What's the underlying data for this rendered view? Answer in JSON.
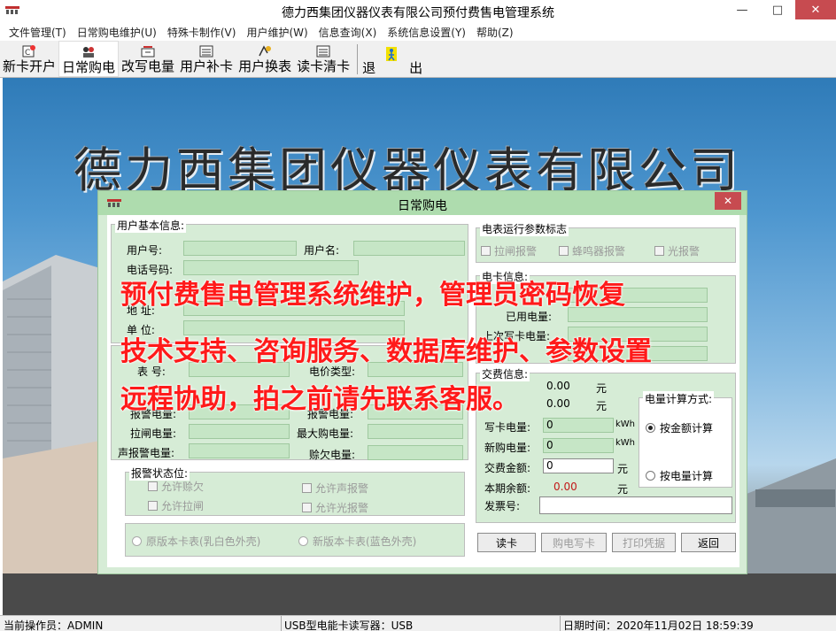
{
  "window": {
    "title": "德力西集团仪器仪表有限公司预付费售电管理系统",
    "minimize": "—",
    "maximize": "□",
    "close": "✕"
  },
  "menu": [
    "文件管理(T)",
    "日常购电维护(U)",
    "特殊卡制作(V)",
    "用户维护(W)",
    "信息查询(X)",
    "系统信息设置(Y)",
    "帮助(Z)"
  ],
  "toolbar": {
    "items": [
      "新卡开户",
      "日常购电",
      "改写电量",
      "用户补卡",
      "用户换表",
      "读卡清卡"
    ],
    "exit_1": "退",
    "exit_2": "出"
  },
  "banner": "德力西集团仪器仪表有限公司",
  "dialog": {
    "title": "日常购电",
    "close": "✕",
    "user_group": {
      "title": "用户基本信息:",
      "user_no": "用户号:",
      "user_name": "用户名:",
      "phone": "电话号码:",
      "address": "地    址:",
      "unit": "单    位:"
    },
    "meter_group": {
      "meter_no": "表    号:",
      "price_type": "电价类型:",
      "alarm_power": "报警电量:",
      "trip_power": "拉闸电量:",
      "max_buy": "最大购电量:",
      "buzzer_power": "声报警电量:",
      "owe_power": "赊欠电量:"
    },
    "alarm_group": {
      "title": "报警状态位:",
      "allow_owe": "允许赊欠",
      "allow_buzzer": "允许声报警",
      "allow_trip": "允许拉闸",
      "allow_light": "允许光报警"
    },
    "version": {
      "old": "原版本卡表(乳白色外壳)",
      "new": "新版本卡表(蓝色外壳)"
    },
    "params_group": {
      "title": "电表运行参数标志",
      "trip_alarm": "拉闸报警",
      "buzzer_alarm": "蜂鸣器报警",
      "light_alarm": "光报警"
    },
    "card_group": {
      "title": "电卡信息:",
      "used_power": "已用电量:",
      "last_power": "上次写卡电量:"
    },
    "pay_group": {
      "title": "交费信息:",
      "amount1": "0.00",
      "unit1": "元",
      "amount2": "0.00",
      "unit2": "元",
      "write_card": "写卡电量:",
      "write_card_val": "0",
      "write_unit": "kWh",
      "new_buy": "新购电量:",
      "new_buy_val": "0",
      "new_buy_unit": "kWh",
      "pay_amount": "交费金额:",
      "pay_amount_val": "0",
      "pay_unit": "元",
      "balance": "本期余额:",
      "balance_val": "0.00",
      "balance_unit": "元",
      "invoice": "发票号:"
    },
    "calc_group": {
      "title": "电量计算方式:",
      "by_amount": "按金额计算",
      "by_power": "按电量计算"
    },
    "buttons": {
      "read": "读卡",
      "buy": "购电写卡",
      "print": "打印凭据",
      "back": "返回"
    }
  },
  "overlay": [
    "预付费售电管理系统维护，管理员密码恢复",
    "技术支持、咨询服务、数据库维护、参数设置",
    "远程协助，拍之前请先联系客服。"
  ],
  "status": {
    "operator": "当前操作员：ADMIN",
    "reader": "USB型电能卡读写器：USB",
    "datetime": "日期时间：2020年11月02日 18:59:39"
  },
  "colors": {
    "dialog_bg": "#d6ecd6",
    "field_bg": "#c6e6c6",
    "overlay_red": "#ff1a1a",
    "close_red": "#c74b50"
  }
}
